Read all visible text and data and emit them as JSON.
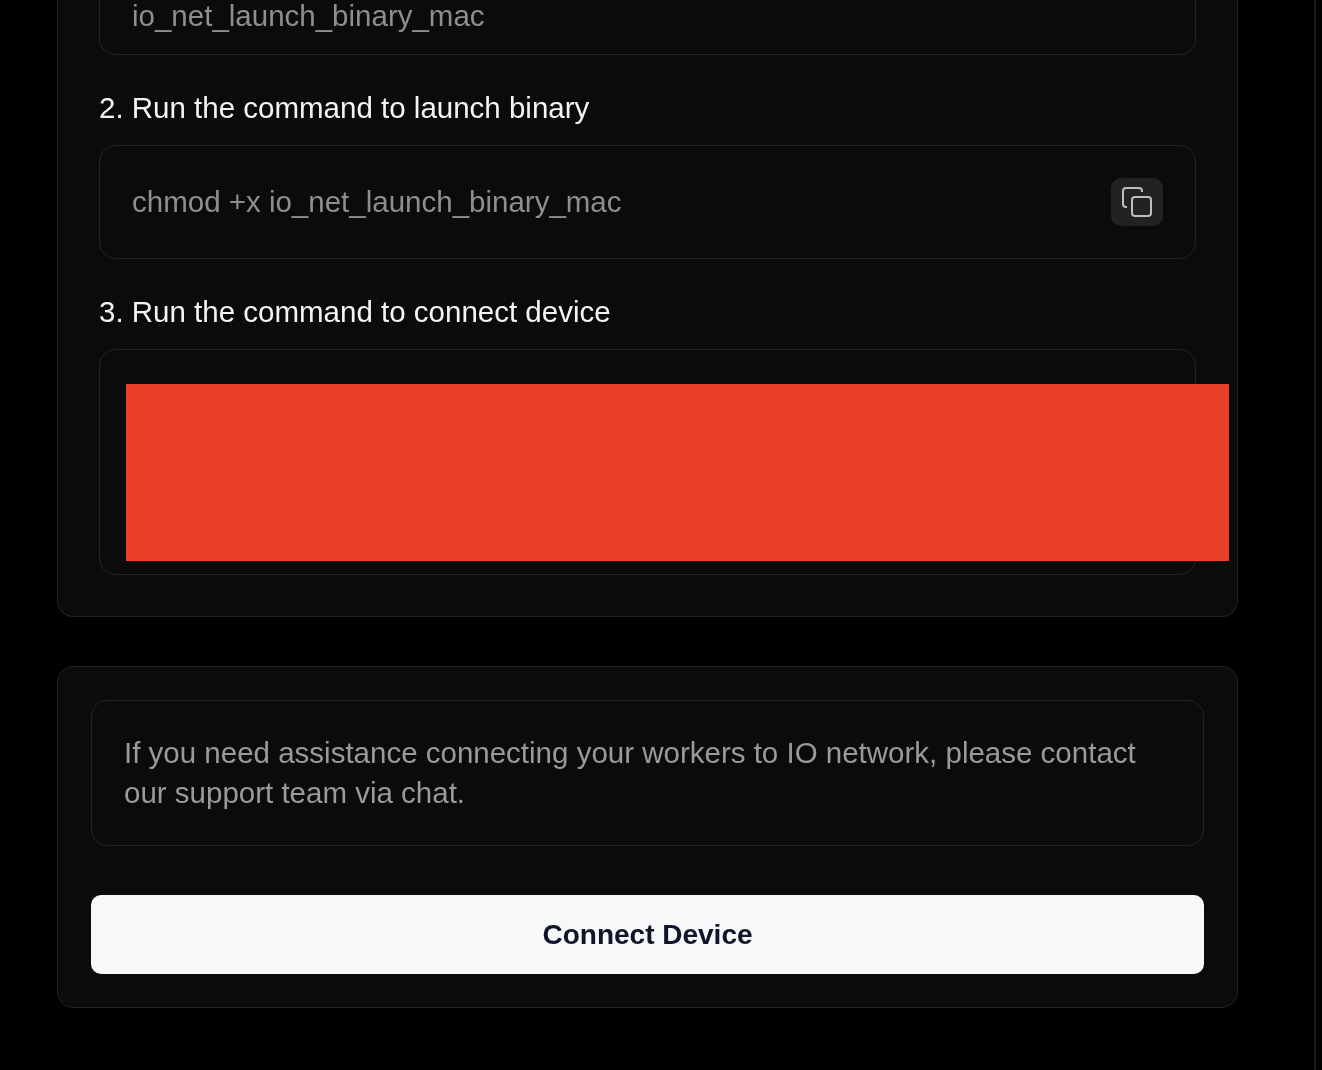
{
  "setup_card": {
    "steps": [
      {
        "kind": "command",
        "command": "io_net_launch_binary_mac",
        "copyable": false
      },
      {
        "kind": "command",
        "label": "2. Run the command to launch binary",
        "command": "chmod +x io_net_launch_binary_mac",
        "copyable": true
      },
      {
        "kind": "redacted",
        "label": "3. Run the command to connect device"
      }
    ]
  },
  "help_card": {
    "message": "If you need assistance connecting your workers to IO network, please contact our support team via chat.",
    "button": "Connect Device"
  }
}
